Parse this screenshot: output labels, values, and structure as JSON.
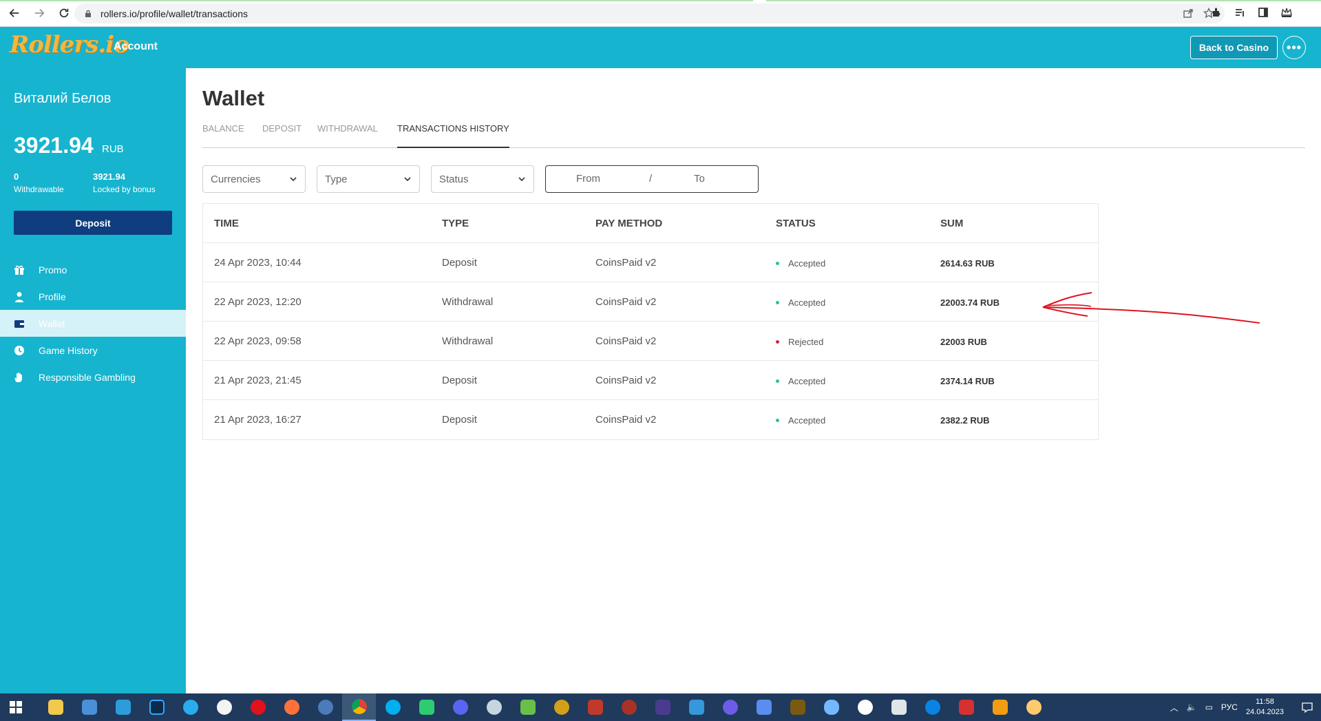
{
  "browser": {
    "url": "rollers.io/profile/wallet/transactions"
  },
  "header": {
    "logo_text": "Rollers.io",
    "section": "Account",
    "back_button": "Back to Casino"
  },
  "sidebar": {
    "user_name": "Виталий Белов",
    "balance": "3921.94",
    "currency": "RUB",
    "withdrawable_value": "0",
    "withdrawable_label": "Withdrawable",
    "locked_value": "3921.94",
    "locked_label": "Locked by bonus",
    "deposit_button": "Deposit",
    "items": [
      {
        "label": "Promo",
        "icon": "gift-icon"
      },
      {
        "label": "Profile",
        "icon": "user-icon"
      },
      {
        "label": "Wallet",
        "icon": "wallet-icon",
        "active": true
      },
      {
        "label": "Game History",
        "icon": "clock-icon"
      },
      {
        "label": "Responsible Gambling",
        "icon": "hand-icon"
      }
    ]
  },
  "main": {
    "title": "Wallet",
    "tabs": [
      "BALANCE",
      "DEPOSIT",
      "WITHDRAWAL",
      "TRANSACTIONS HISTORY"
    ],
    "active_tab": "TRANSACTIONS HISTORY",
    "filters": {
      "currencies": "Currencies",
      "type": "Type",
      "status": "Status",
      "from": "From",
      "separator": "/",
      "to": "To"
    },
    "table": {
      "headers": [
        "TIME",
        "TYPE",
        "PAY METHOD",
        "STATUS",
        "SUM"
      ],
      "rows": [
        {
          "time": "24 Apr 2023, 10:44",
          "type": "Deposit",
          "method": "CoinsPaid v2",
          "status": "Accepted",
          "sum": "2614.63 RUB"
        },
        {
          "time": "22 Apr 2023, 12:20",
          "type": "Withdrawal",
          "method": "CoinsPaid v2",
          "status": "Accepted",
          "sum": "22003.74 RUB"
        },
        {
          "time": "22 Apr 2023, 09:58",
          "type": "Withdrawal",
          "method": "CoinsPaid v2",
          "status": "Rejected",
          "sum": "22003 RUB"
        },
        {
          "time": "21 Apr 2023, 21:45",
          "type": "Deposit",
          "method": "CoinsPaid v2",
          "status": "Accepted",
          "sum": "2374.14 RUB"
        },
        {
          "time": "21 Apr 2023, 16:27",
          "type": "Deposit",
          "method": "CoinsPaid v2",
          "status": "Accepted",
          "sum": "2382.2 RUB"
        }
      ]
    }
  },
  "taskbar": {
    "lang": "РУС",
    "time": "11:58",
    "date": "24.04.2023"
  },
  "colors": {
    "brand": "#16b4cf",
    "deposit_button": "#0f3d7e",
    "accepted": "#2bbf9a",
    "rejected": "#d0243c",
    "annotation": "#e0121e"
  }
}
